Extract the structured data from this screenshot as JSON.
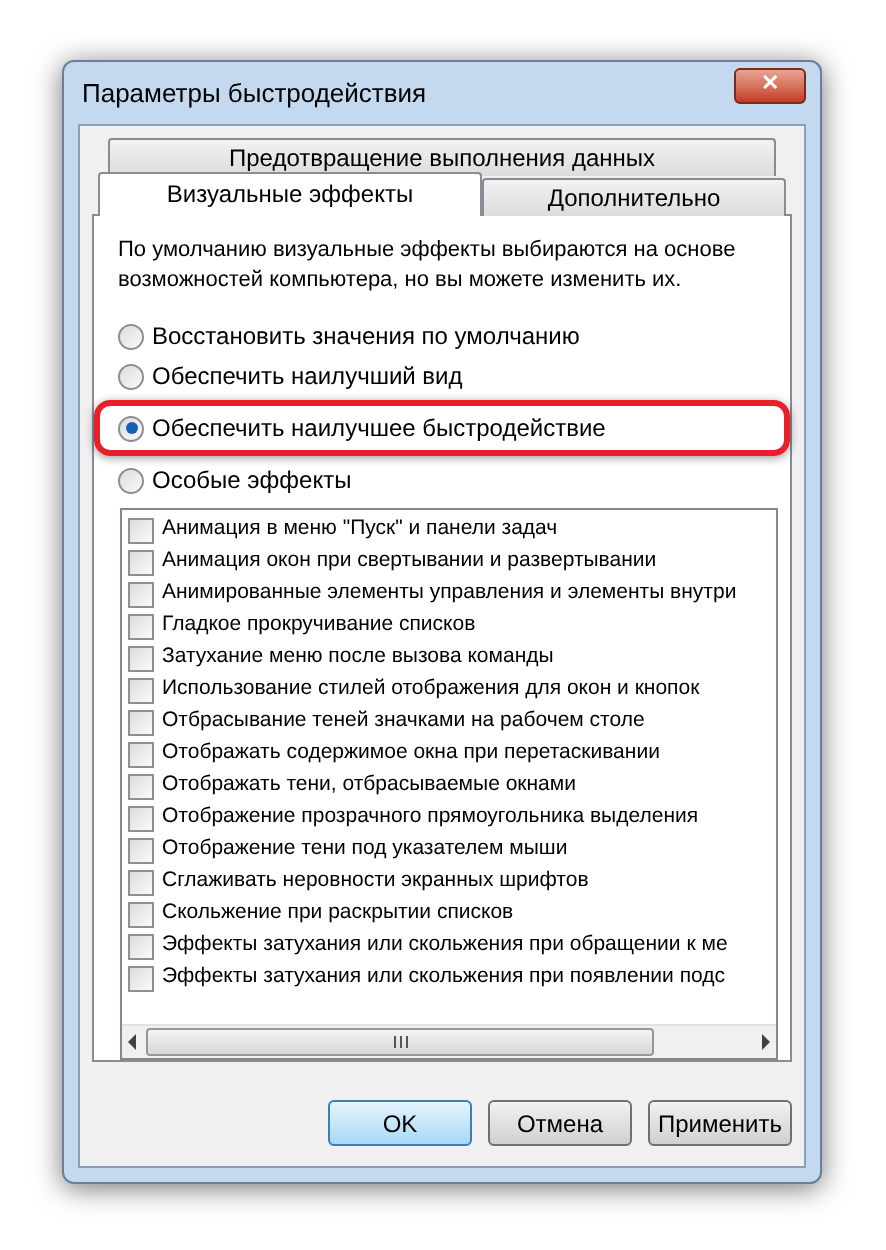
{
  "window": {
    "title": "Параметры быстродействия",
    "close": "✕"
  },
  "tab_rows": [
    [
      {
        "label": "Предотвращение выполнения данных",
        "selected": false
      }
    ],
    [
      {
        "label": "Визуальные эффекты",
        "selected": true
      },
      {
        "label": "Дополнительно",
        "selected": false
      }
    ]
  ],
  "description": "По умолчанию визуальные эффекты выбираются на основе возможностей компьютера, но вы можете изменить их.",
  "options": [
    {
      "label": "Восстановить значения по умолчанию",
      "selected": false,
      "annotated": false
    },
    {
      "label": "Обеспечить наилучший вид",
      "selected": false,
      "annotated": false
    },
    {
      "label": "Обеспечить наилучшее быстродействие",
      "selected": true,
      "annotated": true
    },
    {
      "label": "Особые эффекты",
      "selected": false,
      "annotated": false
    }
  ],
  "effects": [
    {
      "label": "Анимация в меню \"Пуск\" и панели задач",
      "checked": false
    },
    {
      "label": "Анимация окон при свертывании и развертывании",
      "checked": false
    },
    {
      "label": "Анимированные элементы управления и элементы внутри",
      "checked": false
    },
    {
      "label": "Гладкое прокручивание списков",
      "checked": false
    },
    {
      "label": "Затухание меню после вызова команды",
      "checked": false
    },
    {
      "label": "Использование стилей отображения для окон и кнопок",
      "checked": false
    },
    {
      "label": "Отбрасывание теней значками на рабочем столе",
      "checked": false
    },
    {
      "label": "Отображать содержимое окна при перетаскивании",
      "checked": false
    },
    {
      "label": "Отображать тени, отбрасываемые окнами",
      "checked": false
    },
    {
      "label": "Отображение прозрачного прямоугольника выделения",
      "checked": false
    },
    {
      "label": "Отображение тени под указателем мыши",
      "checked": false
    },
    {
      "label": "Сглаживать неровности экранных шрифтов",
      "checked": false
    },
    {
      "label": "Скольжение при раскрытии списков",
      "checked": false
    },
    {
      "label": "Эффекты затухания или скольжения при обращении к ме",
      "checked": false
    },
    {
      "label": "Эффекты затухания или скольжения при появлении подс",
      "checked": false
    }
  ],
  "buttons": [
    {
      "label": "OK",
      "default": true
    },
    {
      "label": "Отмена",
      "default": false
    },
    {
      "label": "Применить",
      "default": false
    }
  ]
}
